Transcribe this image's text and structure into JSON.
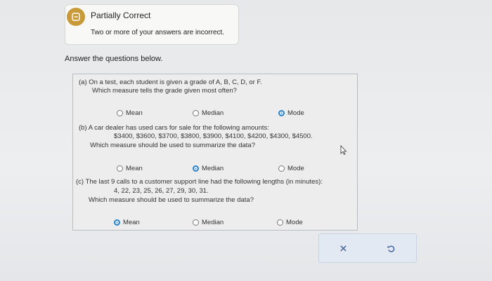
{
  "feedback": {
    "title": "Partially Correct",
    "message": "Two or more of your answers are incorrect."
  },
  "prompt": "Answer the questions below.",
  "questions": {
    "a": {
      "line1": "(a) On a test, each student is given a grade of A, B, C, D, or F.",
      "line2": "Which measure tells the grade given most often?",
      "options": [
        "Mean",
        "Median",
        "Mode"
      ],
      "selected": "Mode"
    },
    "b": {
      "line1": "(b) A car dealer has used cars for sale for the following amounts:",
      "line2": "$3400, $3600, $3700, $3800, $3900, $4100, $4200, $4300, $4500.",
      "line3": "Which measure should be used to summarize the data?",
      "options": [
        "Mean",
        "Median",
        "Mode"
      ],
      "selected": "Median"
    },
    "c": {
      "line1": "(c) The last 9 calls to a customer support line had the following lengths (in minutes):",
      "line2": "4, 22, 23, 25, 26, 27, 29, 30, 31.",
      "line3": "Which measure should be used to summarize the data?",
      "options": [
        "Mean",
        "Median",
        "Mode"
      ],
      "selected": "Mean"
    }
  },
  "actions": {
    "clear_icon": "x-icon",
    "undo_icon": "undo-icon"
  },
  "colors": {
    "feedback_icon": "#c99a3a",
    "radio_selected": "#2e82c9",
    "action_icon": "#3a5f9a"
  }
}
